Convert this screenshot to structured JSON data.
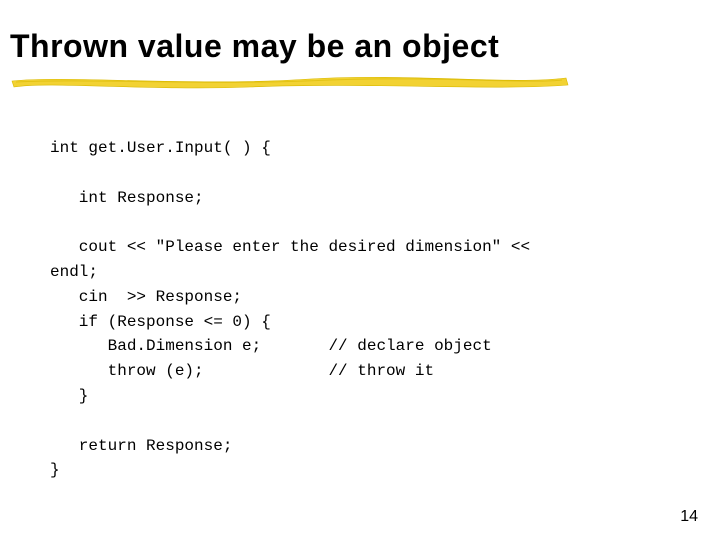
{
  "title": "Thrown value may be an object",
  "code_lines": [
    "int get.User.Input( ) {",
    "",
    "   int Response;",
    "",
    "   cout << \"Please enter the desired dimension\" <<",
    "endl;",
    "   cin  >> Response;",
    "   if (Response <= 0) {",
    "      Bad.Dimension e;       // declare object",
    "      throw (e);             // throw it",
    "   }",
    "",
    "   return Response;",
    "}"
  ],
  "page_number": "14",
  "colors": {
    "underline_yellow": "#f2d233",
    "underline_shadow": "#d9b900"
  }
}
